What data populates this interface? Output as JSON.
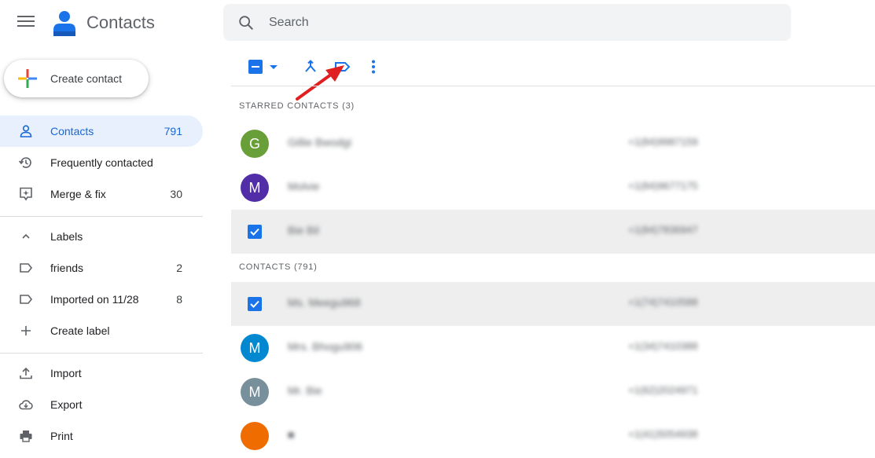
{
  "header": {
    "app_title": "Contacts",
    "search_placeholder": "Search"
  },
  "sidebar": {
    "create_label": "Create contact",
    "items": [
      {
        "label": "Contacts",
        "count": "791"
      },
      {
        "label": "Frequently contacted",
        "count": ""
      },
      {
        "label": "Merge & fix",
        "count": "30"
      }
    ],
    "labels_header": "Labels",
    "labels": [
      {
        "label": "friends",
        "count": "2"
      },
      {
        "label": "Imported on 11/28",
        "count": "8"
      }
    ],
    "create_label_label": "Create label",
    "bottom": [
      {
        "label": "Import"
      },
      {
        "label": "Export"
      },
      {
        "label": "Print"
      }
    ]
  },
  "list": {
    "starred_header": "STARRED CONTACTS (3)",
    "contacts_header": "CONTACTS (791)",
    "starred": [
      {
        "initial": "G",
        "color": "#689f38",
        "selected": false,
        "name": "Gillie Bwodgi",
        "phone": "+1(84)9987159"
      },
      {
        "initial": "M",
        "color": "#512da8",
        "selected": false,
        "name": "Molvie",
        "phone": "+1(84)9677175"
      },
      {
        "initial": "",
        "color": "",
        "selected": true,
        "name": "Bie Bil",
        "phone": "+1(84)7836947"
      }
    ],
    "contacts": [
      {
        "initial": "",
        "color": "",
        "selected": true,
        "name": "Ms. Meegu968",
        "phone": "+1(74)7410588"
      },
      {
        "initial": "M",
        "color": "#0288d1",
        "selected": false,
        "name": "Mrs. Bhogu906",
        "phone": "+1(34)7410388"
      },
      {
        "initial": "M",
        "color": "#78909c",
        "selected": false,
        "name": "Mr. Bie",
        "phone": "+1(62)2024971"
      },
      {
        "initial": "",
        "color": "#ef6c00",
        "selected": false,
        "name": "■",
        "phone": "+1(41)5054938"
      }
    ]
  },
  "colors": {
    "accent": "#1a73e8",
    "annotation_arrow": "#e02020"
  }
}
